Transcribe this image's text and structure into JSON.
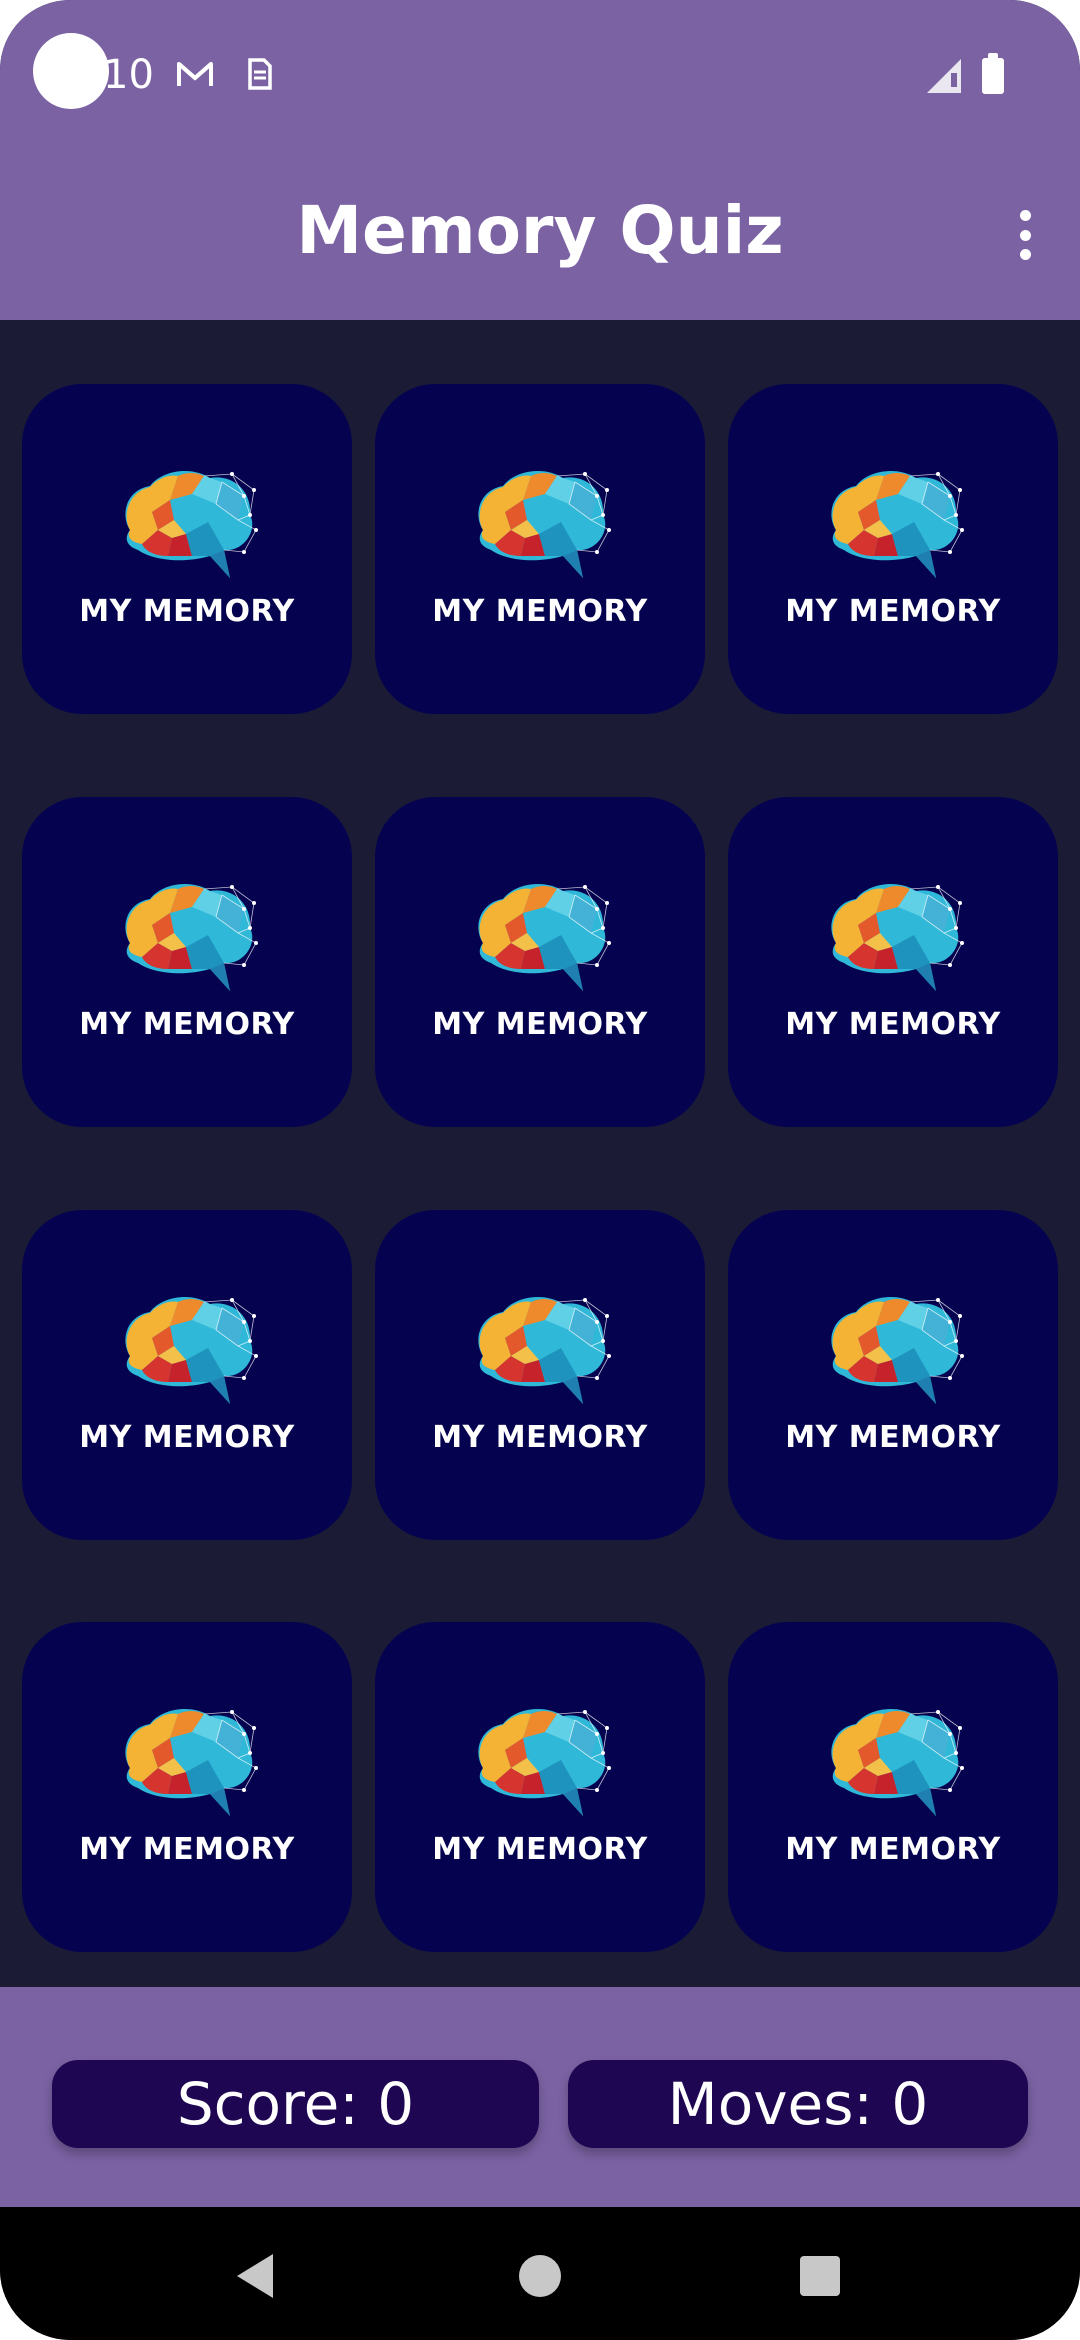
{
  "status_bar": {
    "time": "10"
  },
  "app_bar": {
    "title": "Memory Quiz"
  },
  "cards": [
    {
      "label": "MY MEMORY"
    },
    {
      "label": "MY MEMORY"
    },
    {
      "label": "MY MEMORY"
    },
    {
      "label": "MY MEMORY"
    },
    {
      "label": "MY MEMORY"
    },
    {
      "label": "MY MEMORY"
    },
    {
      "label": "MY MEMORY"
    },
    {
      "label": "MY MEMORY"
    },
    {
      "label": "MY MEMORY"
    },
    {
      "label": "MY MEMORY"
    },
    {
      "label": "MY MEMORY"
    },
    {
      "label": "MY MEMORY"
    }
  ],
  "footer": {
    "score": "Score: 0",
    "moves": "Moves: 0"
  },
  "colors": {
    "accent": "#7b62a3",
    "card": "#05034f",
    "background": "#1b1b36",
    "pill": "#1f0652"
  },
  "icons": [
    "gmail-icon",
    "sim-icon",
    "signal-icon",
    "battery-icon",
    "more-vert-icon",
    "brain-icon",
    "back-icon",
    "home-icon",
    "recents-icon"
  ]
}
